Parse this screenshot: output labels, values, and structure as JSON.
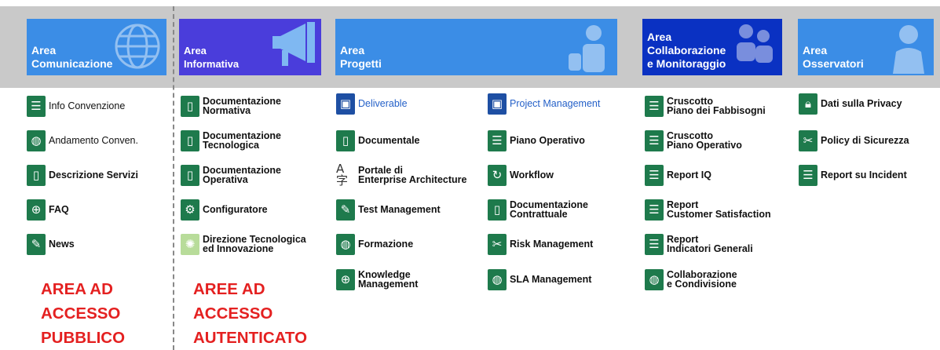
{
  "areas": {
    "comunicazione": {
      "line1": "Area",
      "line2": "Comunicazione",
      "color": "#3b8de6",
      "icon": "globe-icon"
    },
    "informativa": {
      "line1": "Area",
      "line2": "Informativa",
      "color": "#4a3ddb",
      "icon": "megaphone-icon"
    },
    "progetti": {
      "line1": "Area",
      "line2": "Progetti",
      "color": "#3b8de6",
      "icon": "id-card-icon"
    },
    "collaborazione": {
      "line1": "Area",
      "line2": "Collaborazione",
      "line3": "e Monitoraggio",
      "color": "#0a31c2",
      "icon": "people-icon"
    },
    "osservatori": {
      "line1": "Area",
      "line2": "Osservatori",
      "color": "#3b8de6",
      "icon": "person-icon"
    }
  },
  "comunicazione_items": [
    {
      "label": "Info Convenzione",
      "icon": "list-doc-icon"
    },
    {
      "label": "Andamento Conven.",
      "icon": "globe-icon"
    },
    {
      "label": "Descrizione Servizi",
      "icon": "document-icon"
    },
    {
      "label": "FAQ",
      "icon": "web-page-icon"
    },
    {
      "label": "News",
      "icon": "edit-doc-icon"
    }
  ],
  "informativa_items": [
    {
      "line1": "Documentazione",
      "line2": "Normativa",
      "icon": "document-icon"
    },
    {
      "line1": "Documentazione",
      "line2": "Tecnologica",
      "icon": "document-icon"
    },
    {
      "line1": "Documentazione",
      "line2": "Operativa",
      "icon": "document-icon"
    },
    {
      "line1": "Configuratore",
      "line2": "",
      "icon": "gear-icon"
    },
    {
      "line1": "Direzione Tecnologica",
      "line2": "ed Innovazione",
      "icon": "lightbulb-icon"
    }
  ],
  "progetti_left_items": [
    {
      "line1": "Deliverable",
      "line2": "",
      "icon": "id-card-icon"
    },
    {
      "line1": "Documentale",
      "line2": "",
      "icon": "document-icon"
    },
    {
      "line1": "Portale di",
      "line2": "Enterprise Architecture",
      "icon": "translate-icon"
    },
    {
      "line1": "Test Management",
      "line2": "",
      "icon": "edit-doc-icon"
    },
    {
      "line1": "Formazione",
      "line2": "",
      "icon": "globe-icon"
    },
    {
      "line1": "Knowledge",
      "line2": "Management",
      "icon": "web-page-icon"
    }
  ],
  "progetti_right_items": [
    {
      "line1": "Project Management",
      "line2": "",
      "icon": "id-card-icon"
    },
    {
      "line1": "Piano Operativo",
      "line2": "",
      "icon": "list-doc-icon"
    },
    {
      "line1": "Workflow",
      "line2": "",
      "icon": "workflow-icon"
    },
    {
      "line1": "Documentazione",
      "line2": "Contrattuale",
      "icon": "document-icon"
    },
    {
      "line1": "Risk Management",
      "line2": "",
      "icon": "scissors-icon"
    },
    {
      "line1": "SLA Management",
      "line2": "",
      "icon": "globe-icon"
    }
  ],
  "collaborazione_items": [
    {
      "line1": "Cruscotto",
      "line2": "Piano dei Fabbisogni",
      "icon": "list-doc-icon"
    },
    {
      "line1": "Cruscotto",
      "line2": "Piano Operativo",
      "icon": "list-doc-icon"
    },
    {
      "line1": "Report IQ",
      "line2": "",
      "icon": "list-doc-icon"
    },
    {
      "line1": "Report",
      "line2": "Customer Satisfaction",
      "icon": "list-doc-icon"
    },
    {
      "line1": "Report",
      "line2": "Indicatori Generali",
      "icon": "list-doc-icon"
    },
    {
      "line1": "Collaborazione",
      "line2": "e Condivisione",
      "icon": "globe-icon"
    }
  ],
  "osservatori_items": [
    {
      "label": "Dati sulla Privacy",
      "icon": "lock-icon"
    },
    {
      "label": "Policy di Sicurezza",
      "icon": "scissors-icon"
    },
    {
      "label": "Report su Incident",
      "icon": "list-doc-icon"
    }
  ],
  "access_public": {
    "line1": "AREA AD",
    "line2": "ACCESSO",
    "line3": "PUBBLICO"
  },
  "access_auth": {
    "line1": "AREE AD",
    "line2": "ACCESSO",
    "line3": "AUTENTICATO"
  },
  "colors": {
    "icon_green": "#1e7a4c",
    "icon_blue": "#1e4fa3",
    "link_blue": "#2460c8",
    "red": "#e42020"
  }
}
